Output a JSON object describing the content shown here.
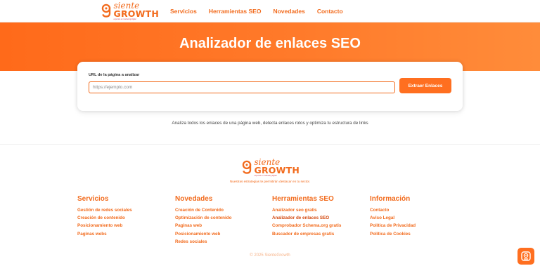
{
  "brand": {
    "siente": "siente",
    "growth": "GROWTH",
    "tagline": "expertos en marketing digital"
  },
  "nav": {
    "items": [
      "Servicios",
      "Herramientas SEO",
      "Novedades",
      "Contacto"
    ]
  },
  "hero": {
    "title": "Analizador de enlaces SEO"
  },
  "form": {
    "label": "URL de la página a analizar",
    "placeholder": "https://ejemplo.com",
    "button": "Extraer Enlaces"
  },
  "hint": "Analiza todos los enlaces de una página web, detecta enlaces rotos y optimiza tu estructura de links",
  "footer": {
    "tagline": "Nuestras estrategias te permitirán destacar en tu sector.",
    "columns": [
      {
        "title": "Servicios",
        "links": [
          "Gestión de redes sociales",
          "Creación de contenido",
          "Posicionamiento web",
          "Paginas webs"
        ]
      },
      {
        "title": "Novedades",
        "links": [
          "Creación de Contenido",
          "Optimización de contenido",
          "Paginas web",
          "Posicionamiento web",
          "Redes sociales"
        ]
      },
      {
        "title": "Herramientas SEO",
        "links": [
          "Analizador seo gratis",
          "Analizador de enlaces SEO",
          "Comprobador Schema.org gratis",
          "Buscador de empresas gratis"
        ]
      },
      {
        "title": "Información",
        "links": [
          "Contacto",
          "Aviso Legal",
          "Política de Privacidad",
          "Política de Cookies"
        ]
      }
    ],
    "copyright": "© 2025 SienteGrowth"
  },
  "colors": {
    "accent": "#f26b1d",
    "button": "#ff6f20"
  },
  "icons": {
    "chat": "chat-bot-icon"
  }
}
